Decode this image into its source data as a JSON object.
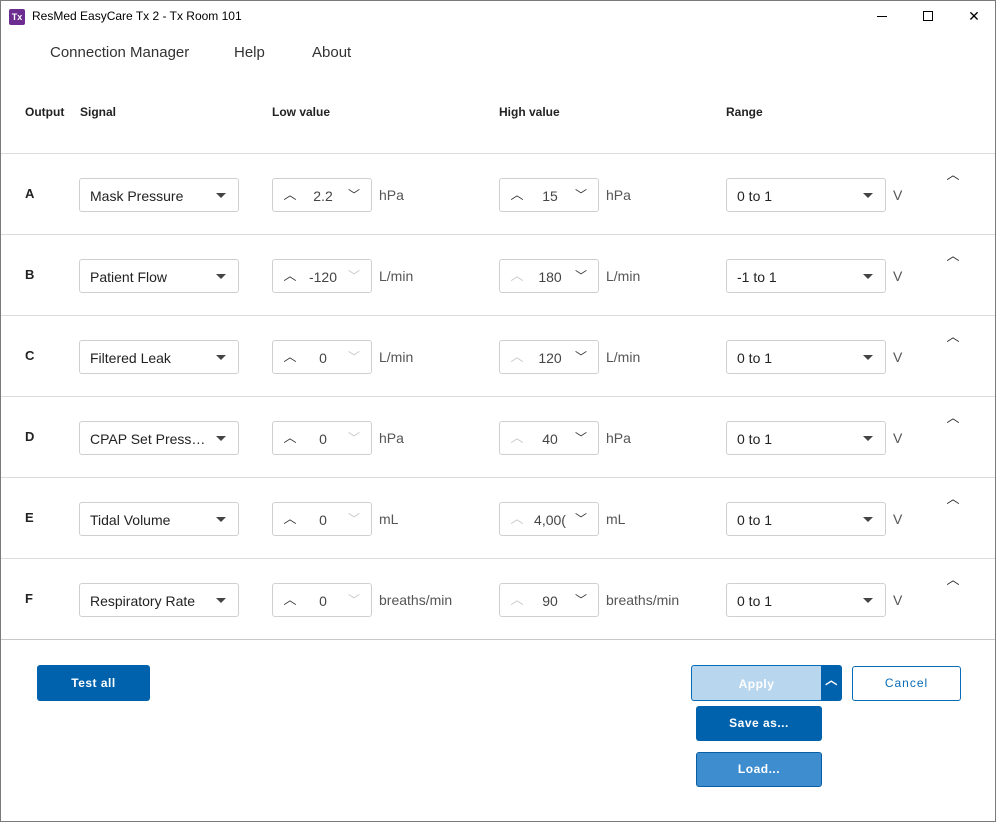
{
  "window": {
    "title": "ResMed EasyCare Tx 2 - Tx Room 101",
    "app_icon_text": "Tx"
  },
  "menu": {
    "items": [
      "Connection Manager",
      "Help",
      "About"
    ]
  },
  "columns": {
    "output": "Output",
    "signal": "Signal",
    "low": "Low value",
    "high": "High value",
    "range": "Range"
  },
  "rows": [
    {
      "letter": "A",
      "signal": "Mask Pressure",
      "low": "2.2",
      "low_unit": "hPa",
      "high": "15",
      "high_unit": "hPa",
      "range": "0 to 1",
      "range_unit": "V"
    },
    {
      "letter": "B",
      "signal": "Patient Flow",
      "low": "-120",
      "low_unit": "L/min",
      "high": "180",
      "high_unit": "L/min",
      "range": "-1 to 1",
      "range_unit": "V"
    },
    {
      "letter": "C",
      "signal": "Filtered Leak",
      "low": "0",
      "low_unit": "L/min",
      "high": "120",
      "high_unit": "L/min",
      "range": "0 to 1",
      "range_unit": "V"
    },
    {
      "letter": "D",
      "signal": "CPAP Set Press…",
      "low": "0",
      "low_unit": "hPa",
      "high": "40",
      "high_unit": "hPa",
      "range": "0 to 1",
      "range_unit": "V"
    },
    {
      "letter": "E",
      "signal": "Tidal Volume",
      "low": "0",
      "low_unit": "mL",
      "high": "4,00(",
      "high_unit": "mL",
      "range": "0 to 1",
      "range_unit": "V"
    },
    {
      "letter": "F",
      "signal": "Respiratory Rate",
      "low": "0",
      "low_unit": "breaths/min",
      "high": "90",
      "high_unit": "breaths/min",
      "range": "0 to 1",
      "range_unit": "V"
    }
  ],
  "buttons": {
    "test_all": "Test all",
    "apply": "Apply",
    "cancel": "Cancel",
    "save_as": "Save as...",
    "load": "Load..."
  },
  "icons": {
    "up": "chevron-up-icon",
    "down": "chevron-down-icon",
    "caret": "caret-down-icon"
  }
}
